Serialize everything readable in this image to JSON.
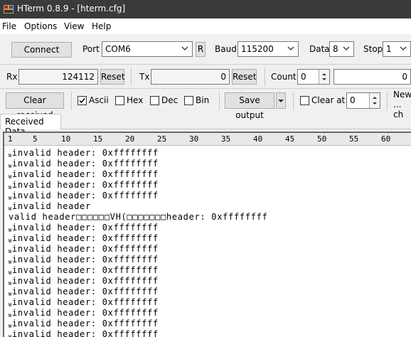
{
  "titlebar": {
    "title": "HTerm 0.8.9 - [hterm.cfg]",
    "icon": "hterm-app-icon"
  },
  "menu": [
    "File",
    "Options",
    "View",
    "Help"
  ],
  "connection": {
    "connect_label": "Connect",
    "port_label": "Port",
    "port_value": "COM6",
    "refresh_label": "R",
    "baud_label": "Baud",
    "baud_value": "115200",
    "data_label": "Data",
    "data_value": "8",
    "stop_label": "Stop",
    "stop_value": "1"
  },
  "counters": {
    "rx_label": "Rx",
    "rx_value": "124112",
    "rx_reset": "Reset",
    "tx_label": "Tx",
    "tx_value": "0",
    "tx_reset": "Reset",
    "count_label": "Count",
    "count_value": "0",
    "count_value2": "0"
  },
  "options": {
    "clear_received": "Clear received",
    "ascii_label": "Ascii",
    "ascii_checked": true,
    "hex_label": "Hex",
    "dec_label": "Dec",
    "bin_label": "Bin",
    "save_output": "Save output",
    "clear_at_label": "Clear at",
    "clear_at_value": "0",
    "newline_line1": "New",
    "newline_line2": "... ch"
  },
  "tab": {
    "label": "Received Data"
  },
  "ruler": [
    "1",
    "5",
    "10",
    "15",
    "20",
    "25",
    "30",
    "35",
    "40",
    "45",
    "50",
    "55",
    "60"
  ],
  "terminal_lines": [
    {
      "marker": "W",
      "text": "invalid header: 0xffffffff"
    },
    {
      "marker": "W",
      "text": "invalid header: 0xffffffff"
    },
    {
      "marker": "W",
      "text": "invalid header: 0xffffffff"
    },
    {
      "marker": "W",
      "text": "invalid header: 0xffffffff"
    },
    {
      "marker": "W",
      "text": "invalid header: 0xffffffff"
    },
    {
      "marker": "W",
      "text": "invalid header"
    },
    {
      "marker": "",
      "text": "valid header□□□□□□VH(□□□□□□□header: 0xffffffff"
    },
    {
      "marker": "W",
      "text": "invalid header: 0xffffffff"
    },
    {
      "marker": "W",
      "text": "invalid header: 0xffffffff"
    },
    {
      "marker": "W",
      "text": "invalid header: 0xffffffff"
    },
    {
      "marker": "W",
      "text": "invalid header: 0xffffffff"
    },
    {
      "marker": "W",
      "text": "invalid header: 0xffffffff"
    },
    {
      "marker": "W",
      "text": "invalid header: 0xffffffff"
    },
    {
      "marker": "W",
      "text": "invalid header: 0xffffffff"
    },
    {
      "marker": "W",
      "text": "invalid header: 0xffffffff"
    },
    {
      "marker": "W",
      "text": "invalid header: 0xffffffff"
    },
    {
      "marker": "W",
      "text": "invalid header: 0xffffffff"
    },
    {
      "marker": "W",
      "text": "invalid header: 0xffffffff"
    }
  ]
}
